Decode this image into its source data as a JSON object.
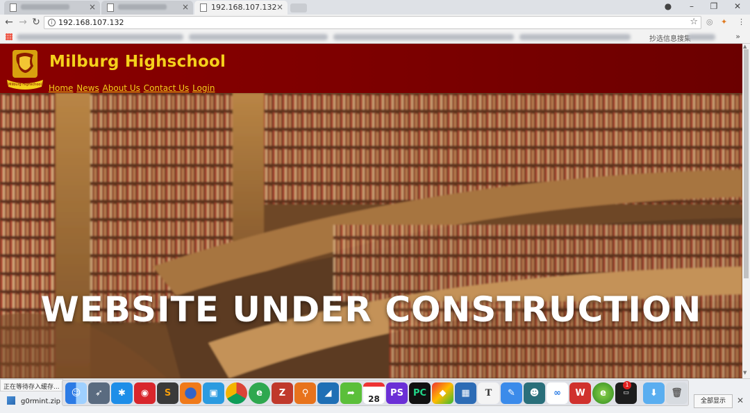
{
  "browser": {
    "tabs": [
      {
        "label": "",
        "active": false
      },
      {
        "label": "",
        "active": false
      },
      {
        "label": "192.168.107.132",
        "active": true
      }
    ],
    "address": "192.168.107.132",
    "bookmarks_more": "»",
    "bookmark_partial": "抄选信息搜集"
  },
  "site": {
    "title": "Milburg Highschool",
    "logo_text": "Milburg Highschool",
    "nav": [
      "Home",
      "News",
      "About Us",
      "Contact Us",
      "Login"
    ],
    "hero_title": "WEBSITE UNDER CONSTRUCTION",
    "colors": {
      "header": "#7a0000",
      "gold": "#f4d01b",
      "hero_text": "#ffffff"
    }
  },
  "status_bar": {
    "status_text": "正在等待存入缓存...",
    "download_file": "g0rmint.zip",
    "show_all": "全部显示"
  },
  "dock": {
    "calendar_date": "28",
    "badge_count": "1",
    "icons": [
      "finder-icon",
      "launchpad-icon",
      "app-icon",
      "netease-music-icon",
      "sublime-icon",
      "firefox-icon",
      "preview-icon",
      "chrome-icon",
      "browser-icon",
      "filezilla-icon",
      "search-icon",
      "wireshark-icon",
      "share-icon",
      "calendar-icon",
      "phpstorm-icon",
      "pycharm-icon",
      "app-icon",
      "window-icon",
      "typora-icon",
      "editor-icon",
      "app-icon",
      "baidu-icon",
      "wps-icon",
      "browser-icon",
      "terminal-icon",
      "folder-icon",
      "trash-icon"
    ]
  }
}
